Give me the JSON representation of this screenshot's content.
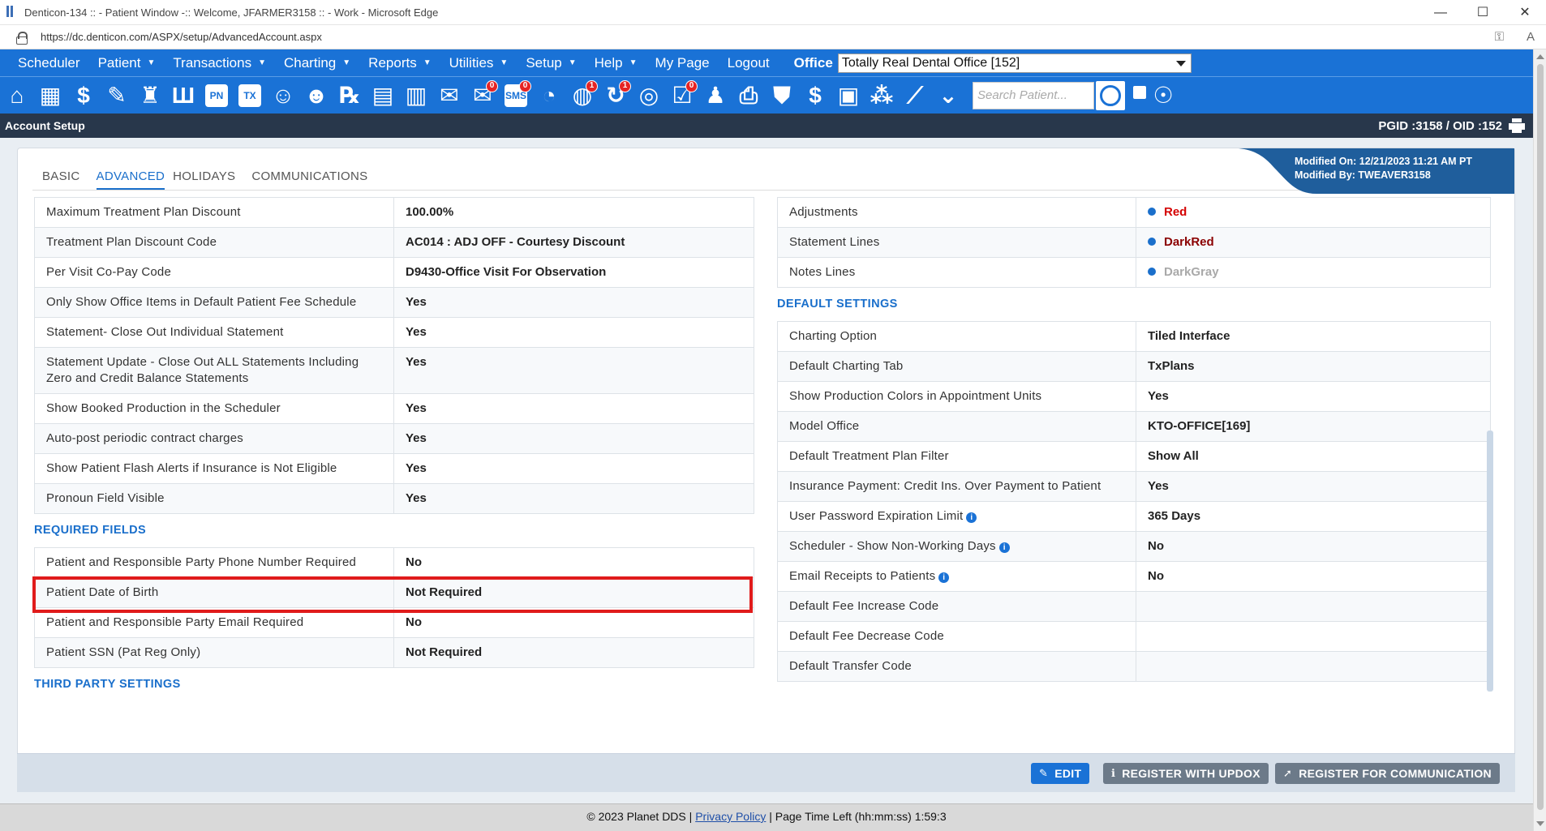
{
  "browser": {
    "window_title": "Denticon-134 :: - Patient Window -:: Welcome, JFARMER3158 :: - Work - Microsoft Edge",
    "url": "https://dc.denticon.com/ASPX/setup/AdvancedAccount.aspx",
    "minimize": "—",
    "maximize": "☐",
    "close": "✕"
  },
  "nav": {
    "menus": [
      {
        "label": "Scheduler",
        "caret": false
      },
      {
        "label": "Patient",
        "caret": true
      },
      {
        "label": "Transactions",
        "caret": true
      },
      {
        "label": "Charting",
        "caret": true
      },
      {
        "label": "Reports",
        "caret": true
      },
      {
        "label": "Utilities",
        "caret": true
      },
      {
        "label": "Setup",
        "caret": true
      },
      {
        "label": "Help",
        "caret": true
      },
      {
        "label": "My Page",
        "caret": false
      },
      {
        "label": "Logout",
        "caret": false
      }
    ],
    "office_label": "Office",
    "office_value": "Totally Real Dental Office [152]"
  },
  "toolbar": {
    "search_placeholder": "Search Patient...",
    "icons": [
      {
        "name": "home-icon",
        "glyph": "⌂"
      },
      {
        "name": "calendar-icon",
        "glyph": "▦"
      },
      {
        "name": "dollar-icon",
        "glyph": "$"
      },
      {
        "name": "edit-icon",
        "glyph": "✎"
      },
      {
        "name": "tooth-icon",
        "glyph": "♜"
      },
      {
        "name": "implant-icon",
        "glyph": "Ш"
      },
      {
        "name": "pn-icon",
        "text": "PN"
      },
      {
        "name": "tx-icon",
        "text": "TX"
      },
      {
        "name": "patient-add-icon",
        "glyph": "☺"
      },
      {
        "name": "family-add-icon",
        "glyph": "☻"
      },
      {
        "name": "rx-icon",
        "glyph": "℞"
      },
      {
        "name": "notes-icon",
        "glyph": "▤"
      },
      {
        "name": "printer-doc-icon",
        "glyph": "▥"
      },
      {
        "name": "mail-icon",
        "glyph": "✉"
      },
      {
        "name": "message-icon",
        "glyph": "✉",
        "badge": "0"
      },
      {
        "name": "sms-icon",
        "text": "SMS",
        "badge": "0"
      },
      {
        "name": "clock-icon",
        "glyph": "◔"
      },
      {
        "name": "web-user-icon",
        "glyph": "◍",
        "badge": "1"
      },
      {
        "name": "refresh-user-icon",
        "glyph": "↻",
        "badge": "1"
      },
      {
        "name": "globe-icon",
        "glyph": "◎"
      },
      {
        "name": "checklist-icon",
        "glyph": "☑",
        "badge": "0"
      },
      {
        "name": "group-icon",
        "glyph": "♟"
      },
      {
        "name": "print-icon",
        "glyph": "⎙"
      },
      {
        "name": "shield-icon",
        "glyph": "⛊"
      },
      {
        "name": "money-shield-icon",
        "glyph": "$"
      },
      {
        "name": "card-icon",
        "glyph": "▣"
      },
      {
        "name": "network-icon",
        "glyph": "⁂"
      },
      {
        "name": "chart-line-icon",
        "glyph": "⟋"
      },
      {
        "name": "chevron-down-shield-icon",
        "glyph": "⌄"
      }
    ]
  },
  "subbar": {
    "title": "Account Setup",
    "ids": "PGID :3158  /  OID :152"
  },
  "tabs": [
    "BASIC",
    "ADVANCED",
    "HOLIDAYS",
    "COMMUNICATIONS"
  ],
  "active_tab": "ADVANCED",
  "modified": {
    "on": "Modified On: 12/21/2023 11:21 AM PT",
    "by": "Modified By: TWEAVER3158"
  },
  "left_rows": [
    {
      "k": "Maximum Treatment Plan Discount",
      "v": "100.00%"
    },
    {
      "k": "Treatment Plan Discount Code",
      "v": "AC014 : ADJ OFF - Courtesy Discount"
    },
    {
      "k": "Per Visit Co-Pay Code",
      "v": "D9430-Office Visit For Observation"
    },
    {
      "k": "Only Show Office Items in Default Patient Fee Schedule",
      "v": "Yes"
    },
    {
      "k": "Statement- Close Out Individual Statement",
      "v": "Yes"
    },
    {
      "k": "Statement Update - Close Out ALL Statements Including Zero and Credit Balance Statements",
      "v": "Yes"
    },
    {
      "k": "Show Booked Production in the Scheduler",
      "v": "Yes"
    },
    {
      "k": "Auto-post periodic contract charges",
      "v": "Yes"
    },
    {
      "k": "Show Patient Flash Alerts if Insurance is Not Eligible",
      "v": "Yes"
    },
    {
      "k": "Pronoun Field Visible",
      "v": "Yes"
    }
  ],
  "required_title": "REQUIRED FIELDS",
  "required_rows": [
    {
      "k": "Patient and Responsible Party Phone Number Required",
      "v": "No"
    },
    {
      "k": "Patient Date of Birth",
      "v": "Not Required"
    },
    {
      "k": "Patient and Responsible Party Email Required",
      "v": "No"
    },
    {
      "k": "Patient SSN (Pat Reg Only)",
      "v": "Not Required"
    }
  ],
  "third_party_title": "THIRD PARTY SETTINGS",
  "right_color_rows": [
    {
      "k": "Adjustments",
      "v": "Red",
      "color": "#d40000"
    },
    {
      "k": "Statement Lines",
      "v": "DarkRed",
      "color": "#8b0000"
    },
    {
      "k": "Notes Lines",
      "v": "DarkGray",
      "color": "#a9a9a9"
    }
  ],
  "default_title": "DEFAULT SETTINGS",
  "default_rows": [
    {
      "k": "Charting Option",
      "v": "Tiled Interface"
    },
    {
      "k": "Default Charting Tab",
      "v": "TxPlans"
    },
    {
      "k": "Show Production Colors in Appointment Units",
      "v": "Yes"
    },
    {
      "k": "Model Office",
      "v": "KTO-OFFICE[169]"
    },
    {
      "k": "Default Treatment Plan Filter",
      "v": "Show All"
    },
    {
      "k": "Insurance Payment: Credit Ins. Over Payment to Patient",
      "v": "Yes"
    },
    {
      "k": "User Password Expiration Limit",
      "v": "365 Days",
      "info": true
    },
    {
      "k": "Scheduler - Show Non-Working Days",
      "v": "No",
      "info": true
    },
    {
      "k": "Email Receipts to Patients",
      "v": "No",
      "info": true
    },
    {
      "k": "Default Fee Increase Code",
      "v": ""
    },
    {
      "k": "Default Fee Decrease Code",
      "v": ""
    },
    {
      "k": "Default Transfer Code",
      "v": ""
    }
  ],
  "buttons": {
    "edit": "EDIT",
    "register_updox": "REGISTER WITH UPDOX",
    "register_comm": "REGISTER FOR COMMUNICATION"
  },
  "footer": {
    "copyright": "© 2023 Planet DDS | ",
    "privacy": "Privacy Policy",
    "time_left": " | Page Time Left (hh:mm:ss) 1:59:3"
  },
  "colors": {
    "brand_blue": "#1a72d6",
    "dark_bar": "#28374b",
    "highlight": "#e01b1b",
    "section_blue": "#1a6fcb"
  }
}
